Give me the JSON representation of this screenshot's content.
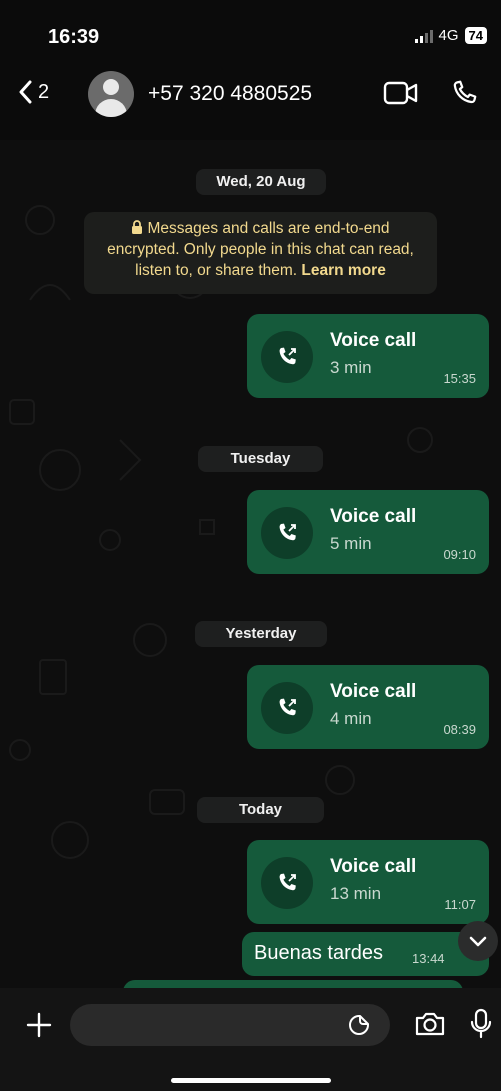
{
  "status_bar": {
    "time": "16:39",
    "network": "4G",
    "battery": "74"
  },
  "header": {
    "back_count": "2",
    "contact_name": "+57 320 4880525"
  },
  "chat": {
    "dates": {
      "first": "Wed, 20 Aug",
      "second": "Tuesday",
      "third": "Yesterday",
      "fourth": "Today"
    },
    "encryption_notice": {
      "text": "Messages and calls are end-to-end encrypted. Only people in this chat can read, listen to, or share them.",
      "link": "Learn more"
    },
    "calls": [
      {
        "title": "Voice call",
        "duration": "3 min",
        "time": "15:35"
      },
      {
        "title": "Voice call",
        "duration": "5 min",
        "time": "09:10"
      },
      {
        "title": "Voice call",
        "duration": "4 min",
        "time": "08:39"
      },
      {
        "title": "Voice call",
        "duration": "13 min",
        "time": "11:07"
      }
    ],
    "text_message": {
      "text": "Buenas tardes",
      "time": "13:44"
    }
  },
  "composer": {
    "placeholder": ""
  },
  "colors": {
    "bubble": "#155a3b",
    "call_icon_bg": "#0e3e29",
    "encryption_text": "#f2d98e",
    "background": "#0e0e0e"
  }
}
